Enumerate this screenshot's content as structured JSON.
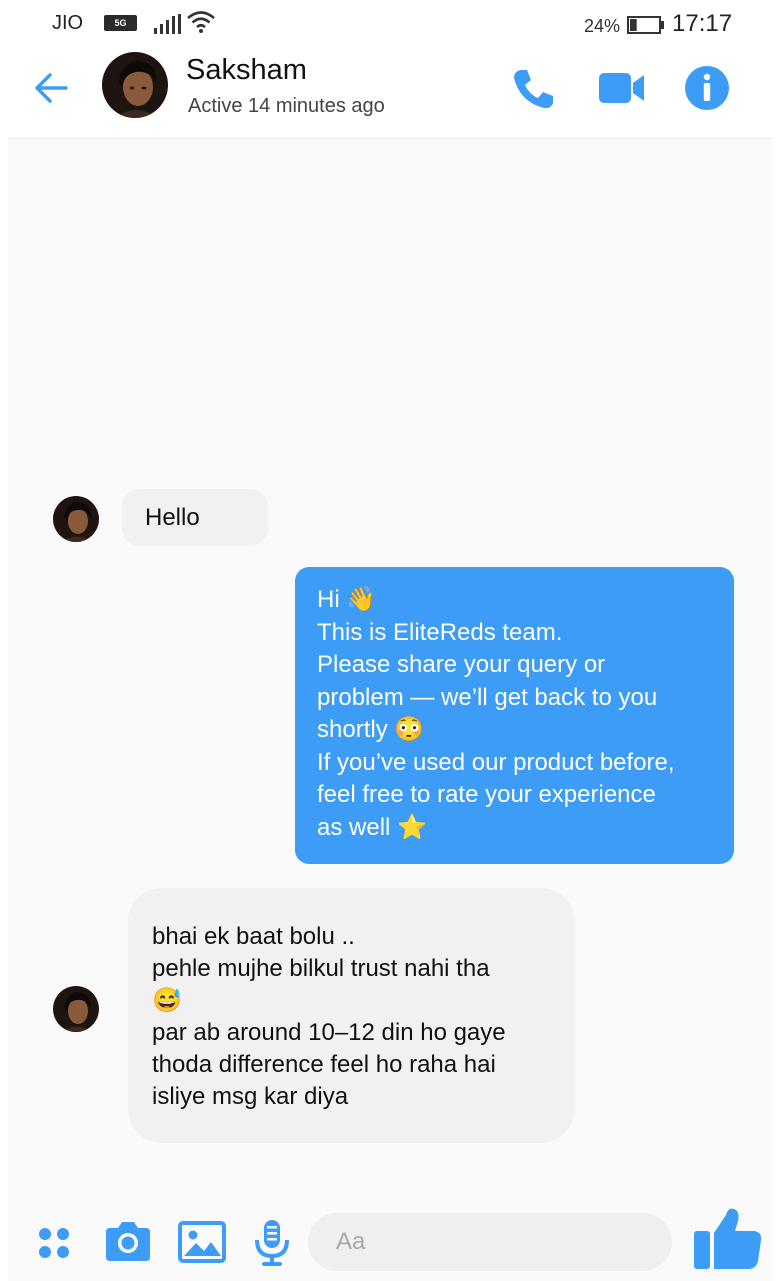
{
  "status_bar": {
    "carrier": "JIO",
    "network_badge": "5G",
    "battery_percent": "24%",
    "battery_level": 0.24,
    "time": "17:17"
  },
  "header": {
    "contact_name": "Saksham",
    "active_status": "Active 14 minutes ago",
    "icons": [
      "back-arrow-icon",
      "phone-icon",
      "video-camera-icon",
      "info-icon"
    ]
  },
  "messages": [
    {
      "direction": "incoming",
      "lines": [
        "Hello"
      ]
    },
    {
      "direction": "outgoing",
      "lines": [
        "Hi 👋",
        "This is EliteReds team.",
        "Please share your query or",
        "problem — we’ll get back to you",
        "shortly 😳",
        "If you’ve used our product before,",
        "feel free to rate your experience",
        "as well ⭐"
      ]
    },
    {
      "direction": "incoming",
      "lines": [
        "bhai ek baat bolu ..",
        "pehle mujhe bilkul trust nahi tha",
        "😅",
        "par ab around 10–12 din ho gaye",
        "thoda difference feel ho raha hai",
        "isliye msg kar diya"
      ]
    }
  ],
  "composer": {
    "placeholder": "Aa",
    "icons": [
      "apps-icon",
      "camera-icon",
      "gallery-icon",
      "microphone-icon",
      "thumbs-up-icon"
    ]
  },
  "colors": {
    "accent": "#3d9df6",
    "incoming_bubble": "#f1f1f1",
    "background": "#fafafa"
  }
}
